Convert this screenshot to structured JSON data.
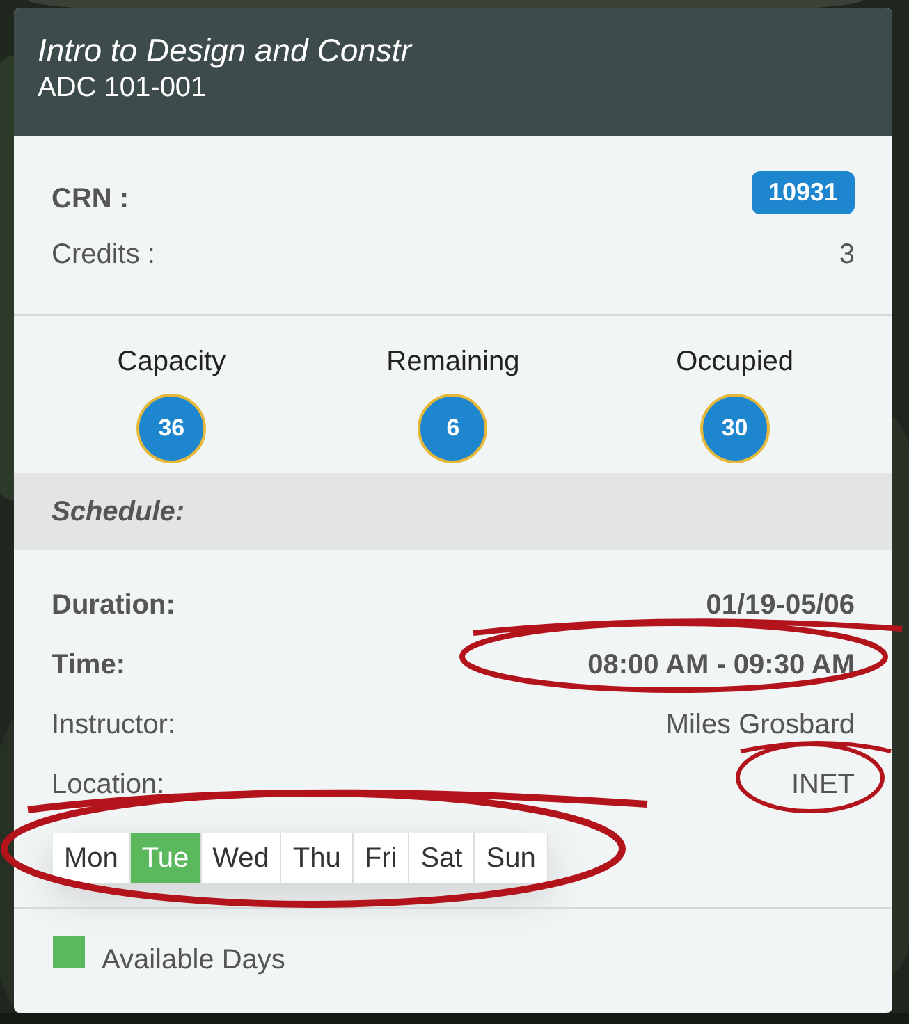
{
  "header": {
    "title": "Intro to Design and Constr",
    "code": "ADC 101-001"
  },
  "crn": {
    "label": "CRN :",
    "value": "10931"
  },
  "credits": {
    "label": "Credits :",
    "value": "3"
  },
  "stats": [
    {
      "label": "Capacity",
      "value": "36"
    },
    {
      "label": "Remaining",
      "value": "6"
    },
    {
      "label": "Occupied",
      "value": "30"
    }
  ],
  "schedule_heading": "Schedule:",
  "details": [
    {
      "label": "Duration:",
      "value": "01/19-05/06",
      "kind": "bold"
    },
    {
      "label": "Time:",
      "value": "08:00 AM - 09:30 AM",
      "kind": "bold"
    },
    {
      "label": "Instructor:",
      "value": "Miles Grosbard",
      "kind": "plain"
    },
    {
      "label": "Location:",
      "value": "INET",
      "kind": "plain"
    }
  ],
  "days": [
    {
      "label": "Mon",
      "selected": false
    },
    {
      "label": "Tue",
      "selected": true
    },
    {
      "label": "Wed",
      "selected": false
    },
    {
      "label": "Thu",
      "selected": false
    },
    {
      "label": "Fri",
      "selected": false
    },
    {
      "label": "Sat",
      "selected": false
    },
    {
      "label": "Sun",
      "selected": false
    }
  ],
  "legend": {
    "label": "Available Days",
    "color": "#5cb85c"
  }
}
